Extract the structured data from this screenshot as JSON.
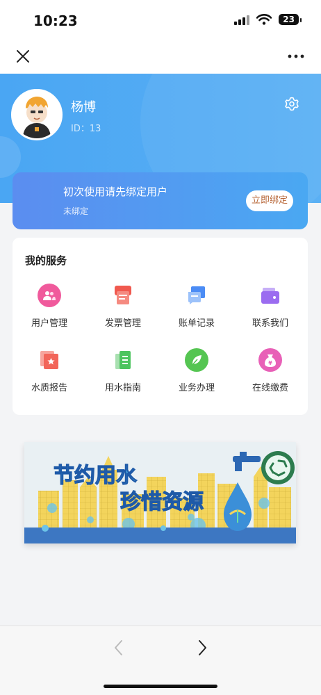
{
  "status_bar": {
    "time": "10:23",
    "battery": "23"
  },
  "user": {
    "name": "杨博",
    "id_label": "ID：13"
  },
  "bind_card": {
    "title": "初次使用请先绑定用户",
    "status": "未绑定",
    "button": "立即绑定"
  },
  "services": {
    "title": "我的服务",
    "items": [
      {
        "label": "用户管理",
        "icon": "users-icon",
        "color": "#f05a9c"
      },
      {
        "label": "发票管理",
        "icon": "invoice-icon",
        "color": "#f0594f"
      },
      {
        "label": "账单记录",
        "icon": "bill-icon",
        "color": "#4b8cf5"
      },
      {
        "label": "联系我们",
        "icon": "wallet-icon",
        "color": "#9b6cf0"
      },
      {
        "label": "水质报告",
        "icon": "report-icon",
        "color": "#f2665a"
      },
      {
        "label": "用水指南",
        "icon": "guide-icon",
        "color": "#4cc45e"
      },
      {
        "label": "业务办理",
        "icon": "leaf-icon",
        "color": "#55c552"
      },
      {
        "label": "在线缴费",
        "icon": "payment-icon",
        "color": "#e860b7"
      }
    ]
  },
  "banner": {
    "line1": "节约用水",
    "line2": "珍惜资源"
  }
}
